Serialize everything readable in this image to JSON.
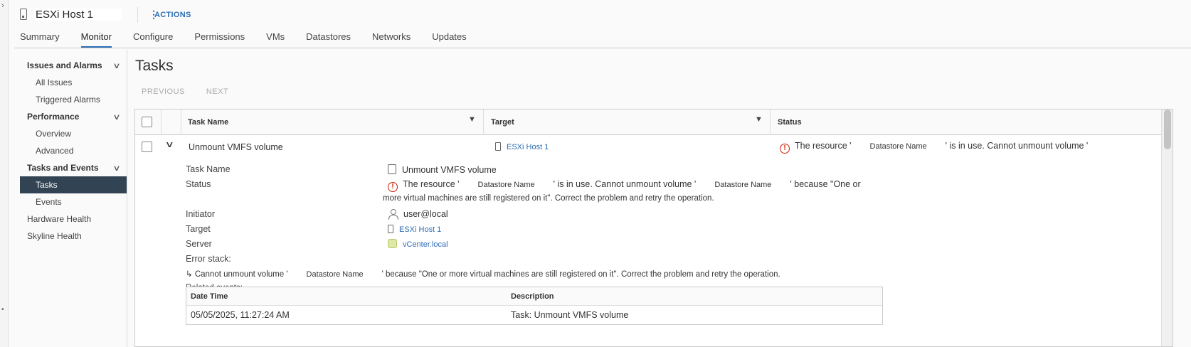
{
  "header": {
    "host_name": "ESXi Host 1",
    "actions_label": "ACTIONS"
  },
  "tabs": [
    {
      "label": "Summary"
    },
    {
      "label": "Monitor"
    },
    {
      "label": "Configure"
    },
    {
      "label": "Permissions"
    },
    {
      "label": "VMs"
    },
    {
      "label": "Datastores"
    },
    {
      "label": "Networks"
    },
    {
      "label": "Updates"
    }
  ],
  "active_tab": "Monitor",
  "sidebar": {
    "issues_group": "Issues and Alarms",
    "all_issues": "All Issues",
    "triggered_alarms": "Triggered Alarms",
    "performance_group": "Performance",
    "overview": "Overview",
    "advanced": "Advanced",
    "tasks_events_group": "Tasks and Events",
    "tasks": "Tasks",
    "events": "Events",
    "hardware_health": "Hardware Health",
    "skyline_health": "Skyline Health"
  },
  "page": {
    "title": "Tasks",
    "previous": "PREVIOUS",
    "next": "NEXT"
  },
  "grid": {
    "columns": {
      "task_name": "Task Name",
      "target": "Target",
      "status": "Status"
    },
    "row": {
      "task_name": "Unmount VMFS volume",
      "target": "ESXi Host 1",
      "status_prefix": "The resource '",
      "status_ds": "Datastore Name",
      "status_suffix": "' is in use. Cannot unmount volume '"
    }
  },
  "details": {
    "labels": {
      "task_name": "Task Name",
      "status": "Status",
      "initiator": "Initiator",
      "target": "Target",
      "server": "Server",
      "error_stack": "Error stack:",
      "related_events": "Related events:"
    },
    "task_name": "Unmount VMFS volume",
    "status_part1": "The resource '",
    "status_ds1": "Datastore Name",
    "status_part2": "' is in use. Cannot unmount volume '",
    "status_ds2": "Datastore Name",
    "status_part3": "' because \"One or",
    "status_line2": "more virtual machines are still registered on it\". Correct the problem and retry the operation.",
    "initiator": "user@local",
    "target": "ESXi Host 1",
    "server": "vCenter.local",
    "error_prefix": "↳ Cannot unmount volume '",
    "error_ds": "Datastore Name",
    "error_suffix": "' because \"One or more virtual machines are still registered on it\". Correct the problem and retry the operation."
  },
  "related_events": {
    "headers": {
      "date_time": "Date Time",
      "description": "Description"
    },
    "rows": [
      {
        "date_time": "05/05/2025, 11:27:24 AM",
        "description": "Task: Unmount VMFS volume"
      }
    ]
  },
  "colors": {
    "accent": "#2d6db5",
    "error": "#c92100",
    "nav_active": "#324454"
  }
}
